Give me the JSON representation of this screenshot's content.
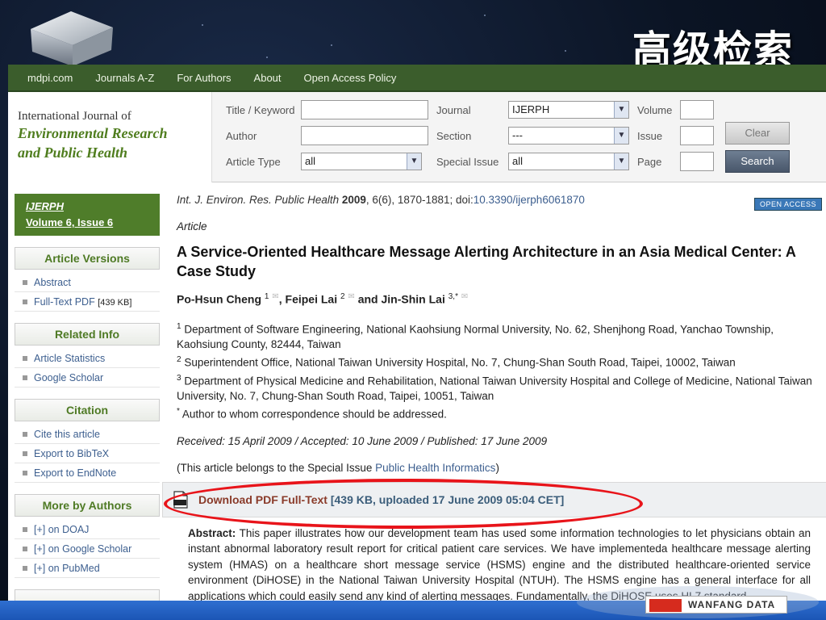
{
  "slide": {
    "title": "高级检索",
    "footer_logo_text": "WANFANG DATA"
  },
  "navbar": {
    "items": [
      "mdpi.com",
      "Journals A-Z",
      "For Authors",
      "About",
      "Open Access Policy"
    ]
  },
  "journal": {
    "line1": "International Journal of",
    "line2": "Environmental Research",
    "line3": "and Public Health"
  },
  "search_form": {
    "title_keyword_label": "Title / Keyword",
    "title_keyword_value": "",
    "author_label": "Author",
    "author_value": "",
    "article_type_label": "Article Type",
    "article_type_value": "all",
    "journal_label": "Journal",
    "journal_value": "IJERPH",
    "section_label": "Section",
    "section_value": "---",
    "special_issue_label": "Special Issue",
    "special_issue_value": "all",
    "volume_label": "Volume",
    "volume_value": "",
    "issue_label": "Issue",
    "issue_value": "",
    "page_label": "Page",
    "page_value": "",
    "clear_label": "Clear",
    "search_label": "Search"
  },
  "sidebar": {
    "journal_link": "IJERPH",
    "volume_link": "Volume 6, Issue 6",
    "article_versions": {
      "title": "Article Versions",
      "items": [
        "Abstract",
        "Full-Text PDF"
      ],
      "pdf_size": "[439 KB]"
    },
    "related_info": {
      "title": "Related Info",
      "items": [
        "Article Statistics",
        "Google Scholar"
      ]
    },
    "citation": {
      "title": "Citation",
      "items": [
        "Cite this article",
        "Export to BibTeX",
        "Export to EndNote"
      ]
    },
    "more_by_authors": {
      "title": "More by Authors",
      "items": [
        "[+] on DOAJ",
        "[+] on Google Scholar",
        "[+] on PubMed"
      ]
    }
  },
  "article": {
    "citation_journal": "Int. J. Environ. Res. Public Health",
    "citation_year": "2009",
    "citation_rest": ", 6(6), 1870-1881; doi:",
    "doi": "10.3390/ijerph6061870",
    "open_access_badge": "OPEN ACCESS",
    "type": "Article",
    "title": "A Service-Oriented Healthcare Message Alerting Architecture in an Asia Medical Center: A Case Study",
    "authors": [
      {
        "name": "Po-Hsun Cheng",
        "sup": "1"
      },
      {
        "name": "Feipei Lai",
        "sup": "2"
      },
      {
        "name": "Jin-Shin Lai",
        "sup": "3,*"
      }
    ],
    "author_sep1": ", ",
    "author_sep2": " and ",
    "affiliations": [
      {
        "sup": "1",
        "text": " Department of Software Engineering, National Kaohsiung Normal University, No. 62, Shenjhong Road, Yanchao Township, Kaohsiung County, 82444, Taiwan"
      },
      {
        "sup": "2",
        "text": " Superintendent Office, National Taiwan University Hospital, No. 7, Chung-Shan South Road, Taipei, 10002, Taiwan"
      },
      {
        "sup": "3",
        "text": " Department of Physical Medicine and Rehabilitation, National Taiwan University Hospital and College of Medicine, National Taiwan University, No. 7, Chung-Shan South Road, Taipei, 10051, Taiwan"
      },
      {
        "sup": "*",
        "text": " Author to whom correspondence should be addressed."
      }
    ],
    "dates": "Received: 15 April 2009 / Accepted: 10 June 2009 / Published: 17 June 2009",
    "special_issue_prefix": "(This article belongs to the Special Issue ",
    "special_issue_link": "Public Health Informatics",
    "special_issue_suffix": ")",
    "download_label": "Download PDF Full-Text",
    "download_meta": " [439 KB, uploaded 17 June 2009 05:04 CET]",
    "abstract_label": "Abstract:",
    "abstract_text": " This paper illustrates how our development team has used some information technologies to let physicians obtain an instant abnormal laboratory result report for critical patient care services. We have implementeda healthcare message alerting system (HMAS) on a healthcare short message service (HSMS) engine and the distributed healthcare-oriented service environment (DiHOSE) in the National Taiwan University Hospital (NTUH). The HSMS engine has a general interface for all applications which could easily send any kind of alerting messages. Fundamentally, the DiHOSE uses HL7 standard"
  }
}
